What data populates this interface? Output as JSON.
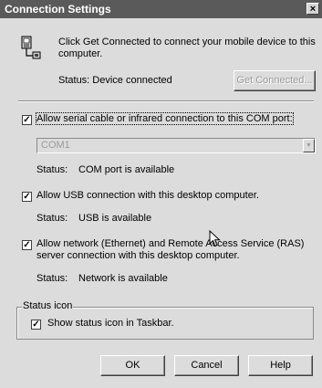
{
  "window": {
    "title": "Connection Settings",
    "close_label": "×"
  },
  "intro": {
    "icon": "handheld-device-icon",
    "text_line1": "Click Get Connected to connect your mobile device to this",
    "text_line2": "computer.",
    "status": "Status: Device connected",
    "get_connected_label": "Get Connected..."
  },
  "serial": {
    "checked": true,
    "label": "Allow serial cable or infrared connection to this COM port:",
    "port_value": "COM1",
    "status_label": "Status:",
    "status_value": "COM port is available"
  },
  "usb": {
    "checked": true,
    "label": "Allow USB connection with this desktop computer.",
    "status_label": "Status:",
    "status_value": "USB is available"
  },
  "network": {
    "checked": true,
    "label_line1": "Allow network (Ethernet) and Remote Access Service (RAS)",
    "label_line2": "server connection with this desktop computer.",
    "status_label": "Status:",
    "status_value": "Network is available"
  },
  "status_icon_group": {
    "title": "Status icon",
    "checked": true,
    "label": "Show status icon in Taskbar."
  },
  "buttons": {
    "ok": "OK",
    "cancel": "Cancel",
    "help": "Help"
  }
}
